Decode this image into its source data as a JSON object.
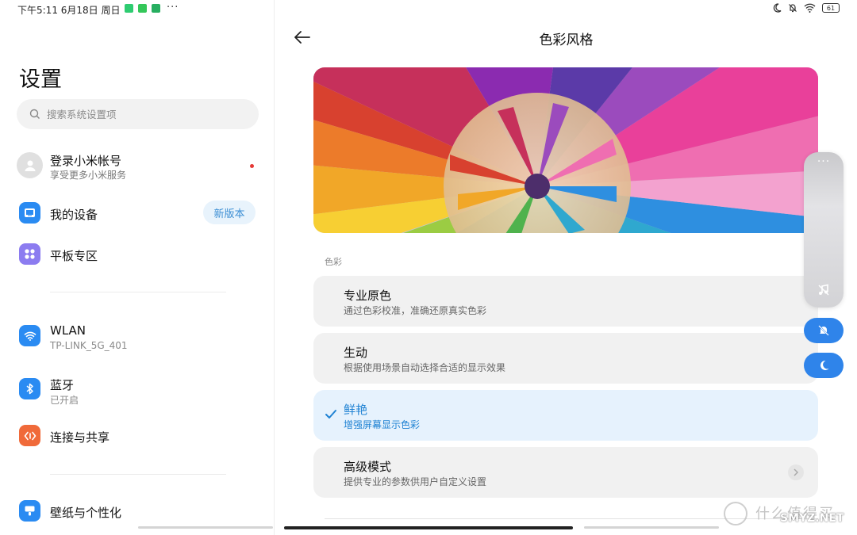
{
  "status_bar": {
    "time": "下午5:11 6月18日 周日",
    "more": "···",
    "battery": "61"
  },
  "sidebar": {
    "title": "设置",
    "search_placeholder": "搜索系统设置项",
    "account": {
      "title": "登录小米帐号",
      "subtitle": "享受更多小米服务"
    },
    "items": [
      {
        "label": "我的设备",
        "badge": "新版本",
        "color": "#2a8bf2"
      },
      {
        "label": "平板专区",
        "color": "#8c7cf0"
      },
      {
        "label": "WLAN",
        "subtitle": "TP-LINK_5G_401",
        "color": "#2a8bf2"
      },
      {
        "label": "蓝牙",
        "subtitle": "已开启",
        "color": "#2a8bf2"
      },
      {
        "label": "连接与共享",
        "color": "#f06a3a"
      },
      {
        "label": "壁纸与个性化",
        "color": "#2a8bf2"
      }
    ]
  },
  "main": {
    "title": "色彩风格",
    "section_label": "色彩",
    "options": [
      {
        "title": "专业原色",
        "subtitle": "通过色彩校准，准确还原真实色彩",
        "selected": false
      },
      {
        "title": "生动",
        "subtitle": "根据使用场景自动选择合适的显示效果",
        "selected": false
      },
      {
        "title": "鲜艳",
        "subtitle": "增强屏幕显示色彩",
        "selected": true
      },
      {
        "title": "高级模式",
        "subtitle": "提供专业的参数供用户自定义设置",
        "selected": false
      }
    ]
  },
  "floating": {
    "dots": "···"
  },
  "watermark": {
    "text1": "什么值得买",
    "text2": "SMYZ.NET"
  },
  "colors": {
    "accent": "#1f82d3",
    "selected_bg": "#e6f2fd",
    "float_button": "#2f84ea"
  }
}
